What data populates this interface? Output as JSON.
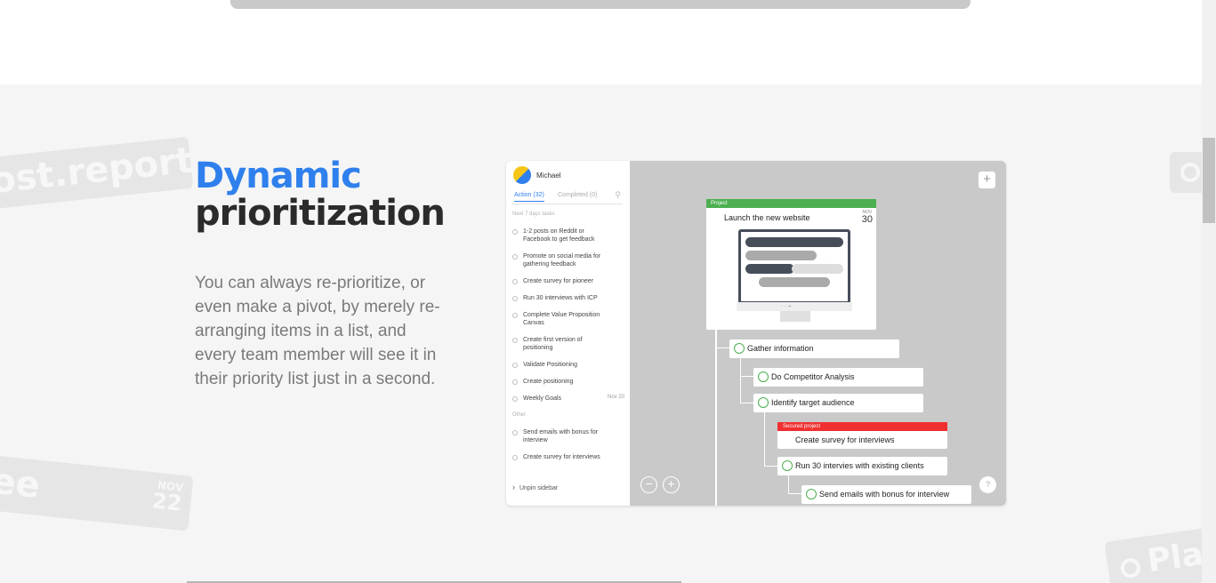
{
  "heading": {
    "line1": "Dynamic",
    "line2": "prioritization"
  },
  "description": "You can always re-prioritize, or even make a pivot, by merely re-arranging items in a list, and every team member will see it in their priority list just in a second.",
  "decorations": {
    "post_report": "ost.report",
    "ee": "ee",
    "ee_month": "NOV",
    "ee_day": "22",
    "pla": "Pla"
  },
  "app": {
    "user_name": "Michael",
    "tabs": {
      "action": "Action (32)",
      "completed": "Completed (0)"
    },
    "groups": {
      "next": "Next 7 days tasks",
      "other": "Other"
    },
    "tasks_next": [
      {
        "text": "1-2 posts on Reddit or Facebook to get feedback",
        "date": ""
      },
      {
        "text": "Promote on social media for gathering feedback",
        "date": ""
      },
      {
        "text": "Create survey for pioneer",
        "date": ""
      },
      {
        "text": "Run 30 interviews with ICP",
        "date": ""
      },
      {
        "text": "Complete Value Proposition Canvas",
        "date": ""
      },
      {
        "text": "Create first version of positioning",
        "date": ""
      },
      {
        "text": "Validate Positioning",
        "date": ""
      },
      {
        "text": "Create positioning",
        "date": ""
      },
      {
        "text": "Weekly Goals",
        "date": "Nov 20"
      }
    ],
    "tasks_other": [
      {
        "text": "Send emails with bonus for interview"
      },
      {
        "text": "Create survey for interviews"
      }
    ],
    "unpin": "Unpin sidebar",
    "canvas": {
      "add_button": "+",
      "zoom_out": "−",
      "zoom_in": "+",
      "help": "?",
      "project": {
        "label": "Project",
        "title": "Launch the new website",
        "month": "NOV",
        "day": "30"
      },
      "nodes": [
        "Gather information",
        "Do Competitor Analysis",
        "Identify target audience",
        "Run 30 intervies with existing clients",
        "Send emails with bonus for interview"
      ],
      "secured": {
        "label": "Secured project",
        "title": "Create survey for interviews"
      }
    }
  },
  "colors": {
    "accent": "#2f80ed",
    "green": "#4caf50",
    "red": "#f03030",
    "canvas": "#c9c9c9"
  }
}
